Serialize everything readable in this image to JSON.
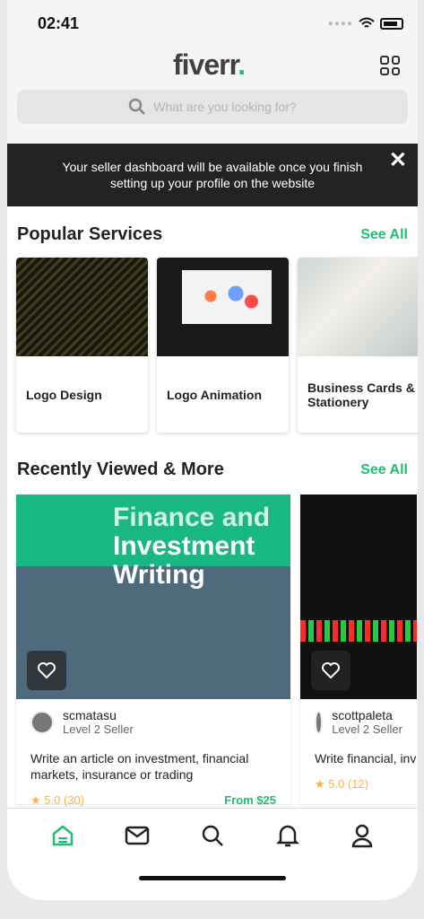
{
  "status": {
    "time": "02:41"
  },
  "header": {
    "logo": "fiverr",
    "logo_dot": ".",
    "search_placeholder": "What are you looking for?"
  },
  "banner": {
    "text": "Your seller dashboard will be available once you finish setting up your profile on the website",
    "close": "✕"
  },
  "popular": {
    "title": "Popular Services",
    "see_all": "See All",
    "items": [
      {
        "label": "Logo Design"
      },
      {
        "label": "Logo Animation"
      },
      {
        "label": "Business Cards & Stationery"
      }
    ]
  },
  "recent": {
    "title": "Recently Viewed & More",
    "see_all": "See All",
    "gigs": [
      {
        "image_text_1": "Finance and",
        "image_text_2": "Investment",
        "image_text_3": "Writing",
        "seller": "scmatasu",
        "level": "Level 2 Seller",
        "title": "Write an article on investment, financial markets, insurance or trading",
        "rating": "★ 5.0 (30)",
        "price": "From $25"
      },
      {
        "seller": "scottpaleta",
        "level": "Level 2 Seller",
        "title": "Write financial, inv content",
        "rating": "★ 5.0 (12)"
      }
    ]
  },
  "colors": {
    "accent": "#1dbf73",
    "banner": "#222325"
  }
}
